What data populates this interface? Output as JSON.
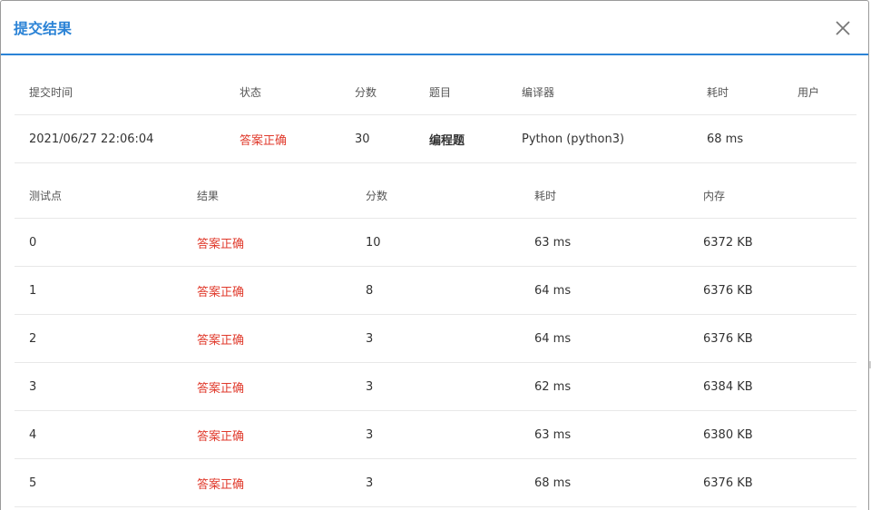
{
  "dialog": {
    "title": "提交结果",
    "close_icon": "close-icon"
  },
  "summary": {
    "headers": [
      "提交时间",
      "状态",
      "分数",
      "题目",
      "编译器",
      "耗时",
      "用户"
    ],
    "row": {
      "time": "2021/06/27 22:06:04",
      "status": "答案正确",
      "score": "30",
      "problem": "编程题",
      "compiler": "Python (python3)",
      "elapsed": "68 ms",
      "user": ""
    }
  },
  "cases": {
    "headers": [
      "测试点",
      "结果",
      "分数",
      "耗时",
      "内存"
    ],
    "rows": [
      {
        "id": "0",
        "result": "答案正确",
        "score": "10",
        "time": "63 ms",
        "memory": "6372 KB"
      },
      {
        "id": "1",
        "result": "答案正确",
        "score": "8",
        "time": "64 ms",
        "memory": "6376 KB"
      },
      {
        "id": "2",
        "result": "答案正确",
        "score": "3",
        "time": "64 ms",
        "memory": "6376 KB"
      },
      {
        "id": "3",
        "result": "答案正确",
        "score": "3",
        "time": "62 ms",
        "memory": "6384 KB"
      },
      {
        "id": "4",
        "result": "答案正确",
        "score": "3",
        "time": "63 ms",
        "memory": "6380 KB"
      },
      {
        "id": "5",
        "result": "答案正确",
        "score": "3",
        "time": "68 ms",
        "memory": "6376 KB"
      }
    ]
  },
  "colors": {
    "accent": "#2b83d6",
    "success_text": "#e03a2c"
  }
}
